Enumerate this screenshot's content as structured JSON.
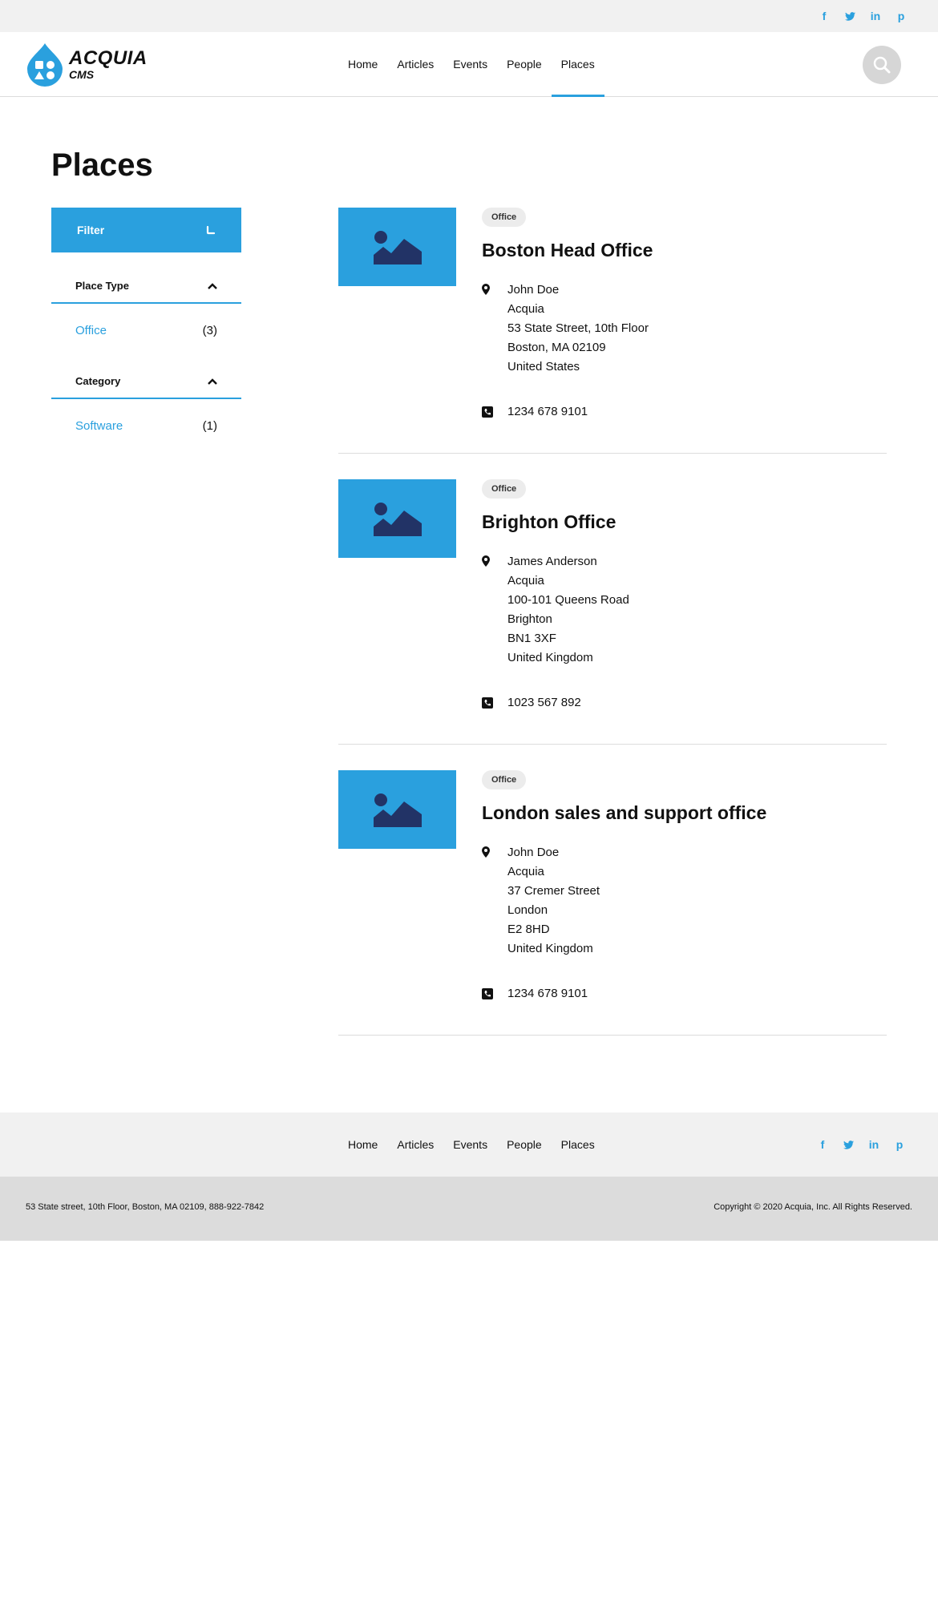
{
  "social": {
    "items": [
      {
        "name": "facebook",
        "glyph": "f"
      },
      {
        "name": "twitter",
        "glyph": "t"
      },
      {
        "name": "linkedin",
        "glyph": "in"
      },
      {
        "name": "pinterest",
        "glyph": "p"
      }
    ]
  },
  "brand": {
    "line1": "ACQUIA",
    "line2": "CMS",
    "accent": "#2aa0de"
  },
  "nav": {
    "items": [
      "Home",
      "Articles",
      "Events",
      "People",
      "Places"
    ],
    "active": "Places"
  },
  "page": {
    "title": "Places"
  },
  "filters": {
    "button_label": "Filter",
    "facets": [
      {
        "title": "Place Type",
        "items": [
          {
            "label": "Office",
            "count": "(3)"
          }
        ]
      },
      {
        "title": "Category",
        "items": [
          {
            "label": "Software",
            "count": "(1)"
          }
        ]
      }
    ]
  },
  "places": [
    {
      "badge": "Office",
      "title": "Boston Head Office",
      "address_lines": [
        "John Doe",
        "Acquia",
        "53 State Street, 10th Floor",
        "Boston, MA 02109",
        "United States"
      ],
      "phone": "1234 678 9101"
    },
    {
      "badge": "Office",
      "title": "Brighton Office",
      "address_lines": [
        "James Anderson",
        "Acquia",
        "100-101 Queens Road",
        "Brighton",
        "BN1 3XF",
        "United Kingdom"
      ],
      "phone": "1023 567 892"
    },
    {
      "badge": "Office",
      "title": "London sales and support office",
      "address_lines": [
        "John Doe",
        "Acquia",
        "37 Cremer Street",
        "London",
        "E2 8HD",
        "United Kingdom"
      ],
      "phone": "1234 678 9101"
    }
  ],
  "footer": {
    "nav": [
      "Home",
      "Articles",
      "Events",
      "People",
      "Places"
    ],
    "address": "53 State street, 10th Floor, Boston, MA 02109, 888-922-7842",
    "copyright": "Copyright © 2020 Acquia, Inc. All Rights Reserved."
  }
}
